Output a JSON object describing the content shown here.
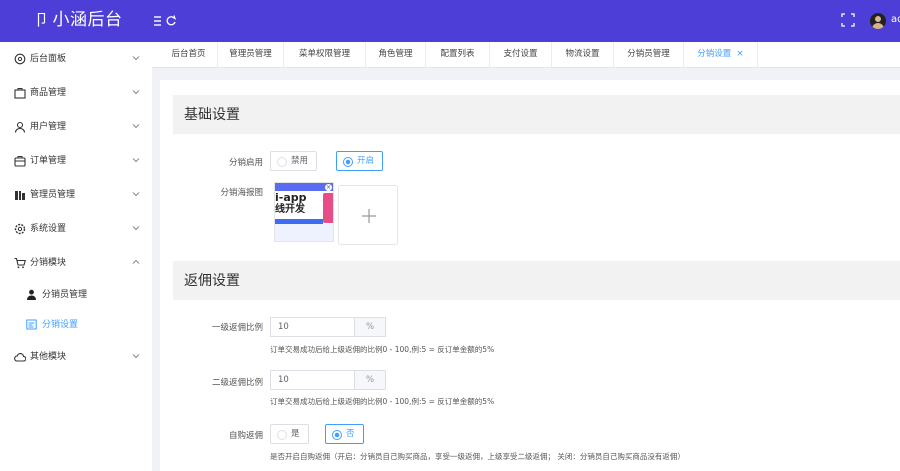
{
  "header": {
    "logo_mark": "卩",
    "app_title": "小涵后台",
    "user_name": "admin"
  },
  "sidebar": {
    "items": [
      {
        "label": "后台面板",
        "icon": "dashboard-icon"
      },
      {
        "label": "商品管理",
        "icon": "goods-icon"
      },
      {
        "label": "用户管理",
        "icon": "user-icon"
      },
      {
        "label": "订单管理",
        "icon": "order-icon"
      },
      {
        "label": "管理员管理",
        "icon": "admin-icon"
      },
      {
        "label": "系统设置",
        "icon": "gear-icon"
      },
      {
        "label": "分销模块",
        "icon": "cart-icon",
        "expanded": true
      },
      {
        "label": "其他模块",
        "icon": "cloud-icon"
      }
    ],
    "sub_items": [
      {
        "label": "分销员管理",
        "icon": "person-icon"
      },
      {
        "label": "分销设置",
        "icon": "settings-card-icon",
        "active": true
      }
    ]
  },
  "tabs": [
    {
      "label": "后台首页"
    },
    {
      "label": "管理员管理"
    },
    {
      "label": "菜单权限管理"
    },
    {
      "label": "角色管理"
    },
    {
      "label": "配置列表"
    },
    {
      "label": "支付设置"
    },
    {
      "label": "物流设置"
    },
    {
      "label": "分销员管理"
    },
    {
      "label": "分销设置",
      "active": true,
      "close": "×"
    }
  ],
  "basic": {
    "title": "基础设置",
    "enable_label": "分销启用",
    "enable_options": [
      "禁用",
      "开启"
    ],
    "enable_value": "开启",
    "poster_label": "分销海报图",
    "poster_text_line1": "i-app",
    "poster_text_line2": "线开发",
    "poster_close": "×"
  },
  "commission": {
    "title": "返佣设置",
    "level1_label": "一级返佣比例",
    "level1_value": "10",
    "level1_unit": "%",
    "level1_help": "订单交易成功后给上级返佣的比例0 - 100,例:5 = 反订单金额的5%",
    "level2_label": "二级返佣比例",
    "level2_value": "10",
    "level2_unit": "%",
    "level2_help": "订单交易成功后给上级返佣的比例0 - 100,例:5 = 反订单金额的5%",
    "self_label": "自购返佣",
    "self_options": [
      "是",
      "否"
    ],
    "self_value": "否",
    "self_help": "是否开启自购返佣（开启：分销员自己购买商品，享受一级返佣，上级享受二级返佣；  关闭：分销员自己购买商品没有返佣）"
  },
  "colors": {
    "header_bg": "#4c3ed6",
    "accent": "#409eff"
  }
}
